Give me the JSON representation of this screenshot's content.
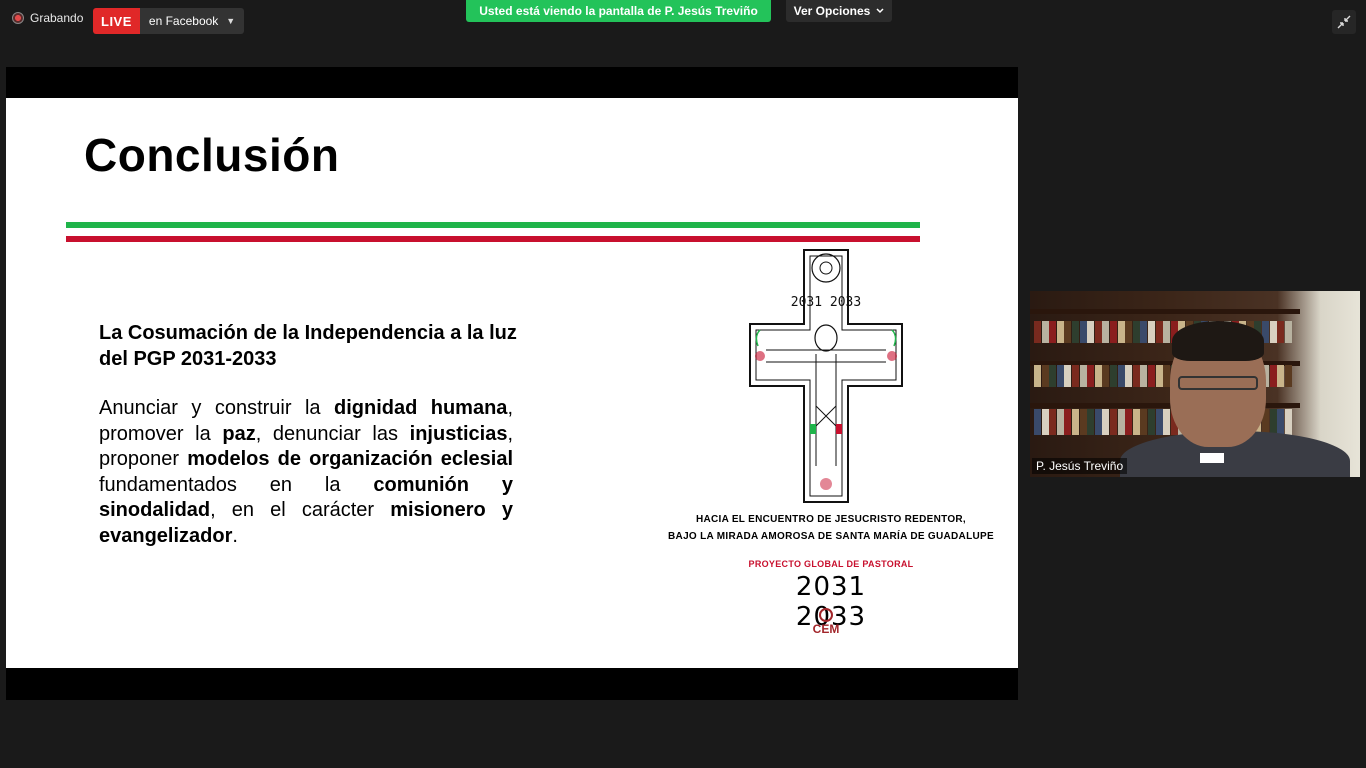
{
  "recording": {
    "label": "Grabando"
  },
  "live": {
    "badge": "LIVE",
    "destination": "en Facebook"
  },
  "share_banner": "Usted está viendo la pantalla de P. Jesús Treviño",
  "view_options": {
    "label": "Ver Opciones"
  },
  "slide": {
    "title": "Conclusión",
    "subtitle": "La Cosumación de la Independencia a la luz del PGP 2031-2033",
    "body": [
      {
        "text": "Anunciar y construir la ",
        "bold": false
      },
      {
        "text": "dignidad humana",
        "bold": true
      },
      {
        "text": ", promover la ",
        "bold": false
      },
      {
        "text": "paz",
        "bold": true
      },
      {
        "text": ", denunciar las ",
        "bold": false
      },
      {
        "text": "injusticias",
        "bold": true
      },
      {
        "text": ", proponer ",
        "bold": false
      },
      {
        "text": "modelos de organización eclesial",
        "bold": true
      },
      {
        "text": " fundamentados en la ",
        "bold": false
      },
      {
        "text": "comunión y sinodalidad",
        "bold": true
      },
      {
        "text": ", en el carácter ",
        "bold": false
      },
      {
        "text": "misionero y evangelizador",
        "bold": true
      },
      {
        "text": ".",
        "bold": false
      }
    ],
    "art_years": "2031 2033",
    "caption_line1": "HACIA EL ENCUENTRO DE JESUCRISTO REDENTOR,",
    "caption_line2": "BAJO LA MIRADA AMOROSA DE SANTA MARÍA DE GUADALUPE",
    "project_label": "PROYECTO GLOBAL DE PASTORAL",
    "project_years": "2031 2033",
    "logo_text": "CEM",
    "colors": {
      "green": "#1fb44a",
      "red": "#c8102e"
    }
  },
  "participant": {
    "name": "P. Jesús Treviño"
  },
  "colors": {
    "live_red": "#e02828",
    "share_green": "#23c35a",
    "background": "#1a1a1a"
  },
  "icons": {
    "exit_fullscreen": "exit-fullscreen-icon",
    "caret": "caret-down-icon",
    "recording": "recording-dot-icon"
  }
}
